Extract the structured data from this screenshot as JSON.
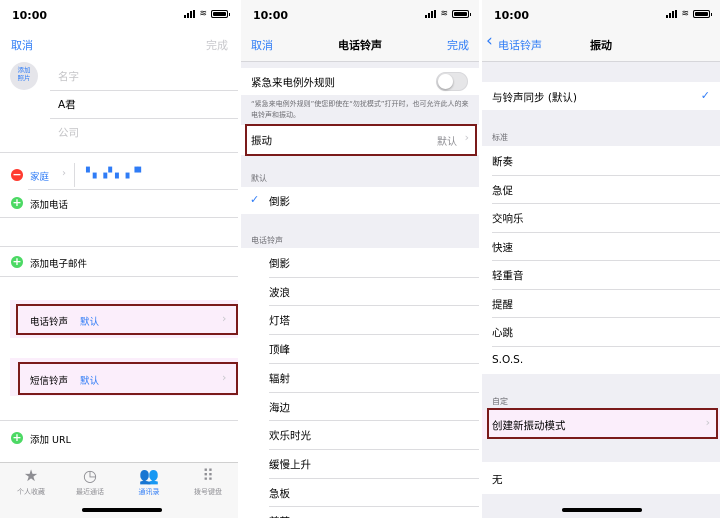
{
  "status": {
    "time": "10:00"
  },
  "contact": {
    "cancel": "取消",
    "done": "完成",
    "add_photo": "添加\n照片",
    "first_name_placeholder": "名字",
    "last_name_value": "A君",
    "company_placeholder": "公司",
    "phone_label": "家庭",
    "phone_value": "▘▖▗ ▘▖▗ ▝▘",
    "add_phone": "添加电话",
    "add_email": "添加电子邮件",
    "ringtone_label": "电话铃声",
    "ringtone_value": "默认",
    "texttone_label": "短信铃声",
    "texttone_value": "默认",
    "add_url": "添加 URL",
    "tabs": [
      "个人收藏",
      "最近通话",
      "通讯录",
      "拨号键盘"
    ]
  },
  "ringtone": {
    "cancel": "取消",
    "title": "电话铃声",
    "done": "完成",
    "emergency_label": "紧急来电例外规则",
    "emergency_note": "“紧急来电例外规则”使您即使在“勿扰模式”打开时，也可允许此人的来电铃声和振动。",
    "vibration_label": "振动",
    "vibration_value": "默认",
    "default_header": "默认",
    "default_item": "倒影",
    "tones_header": "电话铃声",
    "tones": [
      "倒影",
      "波浪",
      "灯塔",
      "顶峰",
      "辐射",
      "海边",
      "欢乐时光",
      "缓慢上升",
      "急板",
      "煎茶"
    ]
  },
  "vibration": {
    "back": "电话铃声",
    "title": "振动",
    "sync_item": "与铃声同步 (默认)",
    "standard_header": "标准",
    "standard_items": [
      "断奏",
      "急促",
      "交响乐",
      "快速",
      "轻重音",
      "提醒",
      "心跳",
      "S.O.S."
    ],
    "custom_header": "自定",
    "create_new": "创建新振动模式",
    "none": "无"
  },
  "colors": {
    "accent": "#2f7cf6",
    "highlight_border": "#7a1a1a",
    "add_green": "#4cd964",
    "delete_red": "#ff3b30"
  }
}
